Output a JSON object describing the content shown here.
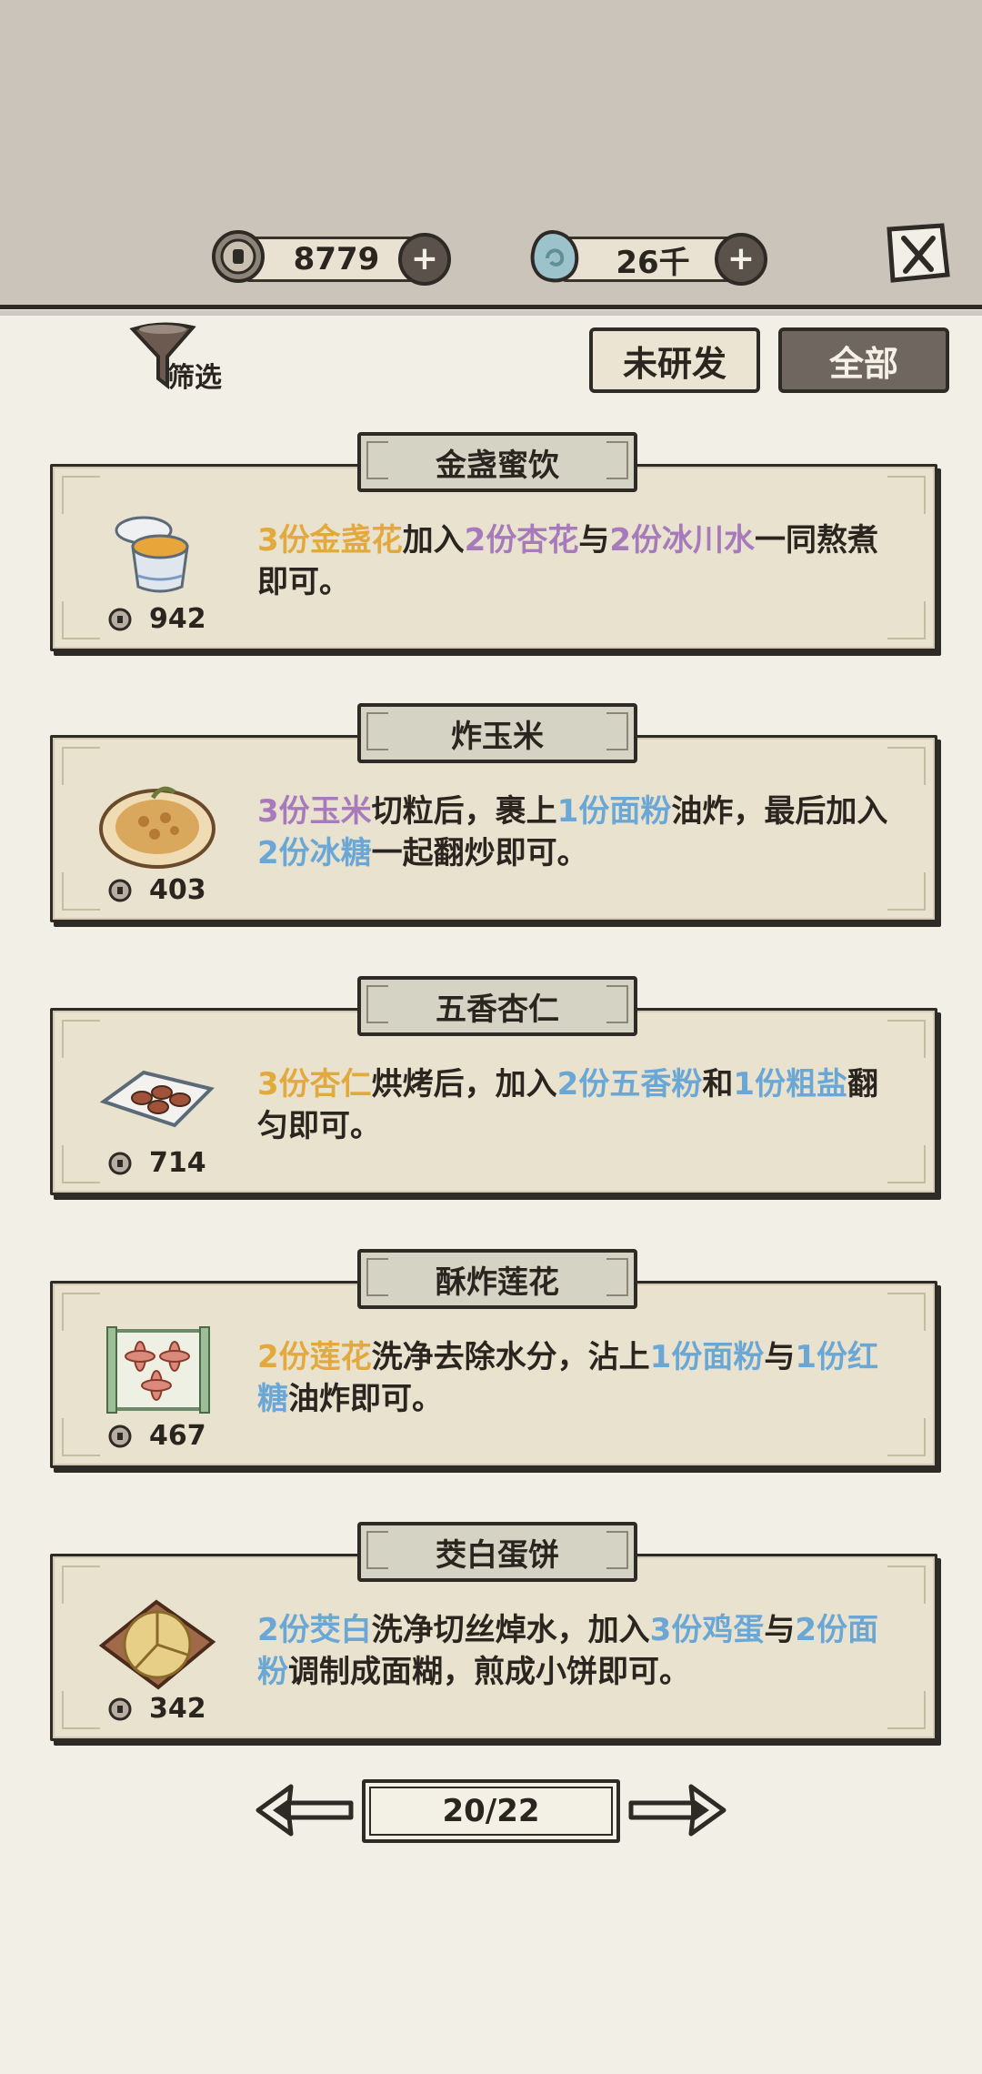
{
  "header": {
    "coins_value": "8779",
    "gems_value": "26千"
  },
  "toolbar": {
    "filter_label": "筛选",
    "tab_undeveloped": "未研发",
    "tab_all": "全部"
  },
  "recipes": [
    {
      "name": "金盏蜜饮",
      "price": "942",
      "desc": [
        {
          "t": "3份金盏花",
          "c": "orange"
        },
        {
          "t": "加入",
          "c": ""
        },
        {
          "t": "2份杏花",
          "c": "purple"
        },
        {
          "t": "与",
          "c": ""
        },
        {
          "t": "2份冰川水",
          "c": "purple"
        },
        {
          "t": "一同熬煮即可。",
          "c": ""
        }
      ]
    },
    {
      "name": "炸玉米",
      "price": "403",
      "desc": [
        {
          "t": "3份玉米",
          "c": "purple"
        },
        {
          "t": "切粒后，裹上",
          "c": ""
        },
        {
          "t": "1份面粉",
          "c": "blue"
        },
        {
          "t": "油炸，最后加入",
          "c": ""
        },
        {
          "t": "2份冰糖",
          "c": "blue"
        },
        {
          "t": "一起翻炒即可。",
          "c": ""
        }
      ]
    },
    {
      "name": "五香杏仁",
      "price": "714",
      "desc": [
        {
          "t": "3份杏仁",
          "c": "orange"
        },
        {
          "t": "烘烤后，加入",
          "c": ""
        },
        {
          "t": "2份五香粉",
          "c": "blue"
        },
        {
          "t": "和",
          "c": ""
        },
        {
          "t": "1份粗盐",
          "c": "blue"
        },
        {
          "t": "翻匀即可。",
          "c": ""
        }
      ]
    },
    {
      "name": "酥炸莲花",
      "price": "467",
      "desc": [
        {
          "t": "2份莲花",
          "c": "orange"
        },
        {
          "t": "洗净去除水分，沾上",
          "c": ""
        },
        {
          "t": "1份面粉",
          "c": "blue"
        },
        {
          "t": "与",
          "c": ""
        },
        {
          "t": "1份红糖",
          "c": "blue"
        },
        {
          "t": "油炸即可。",
          "c": ""
        }
      ]
    },
    {
      "name": "茭白蛋饼",
      "price": "342",
      "desc": [
        {
          "t": "2份茭白",
          "c": "blue"
        },
        {
          "t": "洗净切丝焯水，加入",
          "c": ""
        },
        {
          "t": "3份鸡蛋",
          "c": "blue"
        },
        {
          "t": "与",
          "c": ""
        },
        {
          "t": "2份面粉",
          "c": "blue"
        },
        {
          "t": "调制成面糊，煎成小饼即可。",
          "c": ""
        }
      ]
    }
  ],
  "pager": {
    "label": "20/22"
  }
}
